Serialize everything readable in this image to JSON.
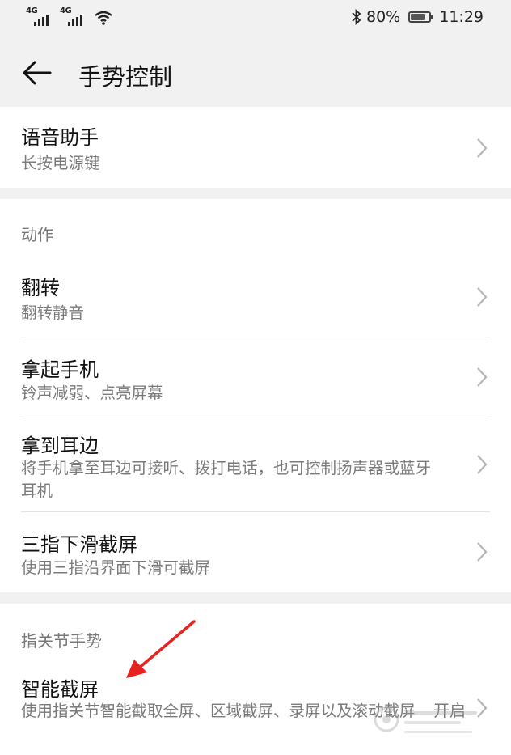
{
  "status_bar": {
    "signal1_label": "4G",
    "signal2_label": "4G",
    "battery_percent": "80%",
    "battery_level": 0.8,
    "time": "11:29"
  },
  "header": {
    "title": "手势控制"
  },
  "voice_assistant": {
    "title": "语音助手",
    "subtitle": "长按电源键"
  },
  "actions_section": {
    "label": "动作",
    "items": [
      {
        "title": "翻转",
        "subtitle": "翻转静音"
      },
      {
        "title": "拿起手机",
        "subtitle": "铃声减弱、点亮屏幕"
      },
      {
        "title": "拿到耳边",
        "subtitle": "将手机拿至耳边可接听、拨打电话，也可控制扬声器或蓝牙耳机"
      },
      {
        "title": "三指下滑截屏",
        "subtitle": "使用三指沿界面下滑可截屏"
      }
    ]
  },
  "knuckle_section": {
    "label": "指关节手势",
    "items": [
      {
        "title": "智能截屏",
        "subtitle": "使用指关节智能截取全屏、区域截屏、录屏以及滚动截屏",
        "value": "开启"
      }
    ]
  },
  "colors": {
    "background": "#f1f1f1",
    "card": "#ffffff",
    "annotation": "#e8221e"
  }
}
